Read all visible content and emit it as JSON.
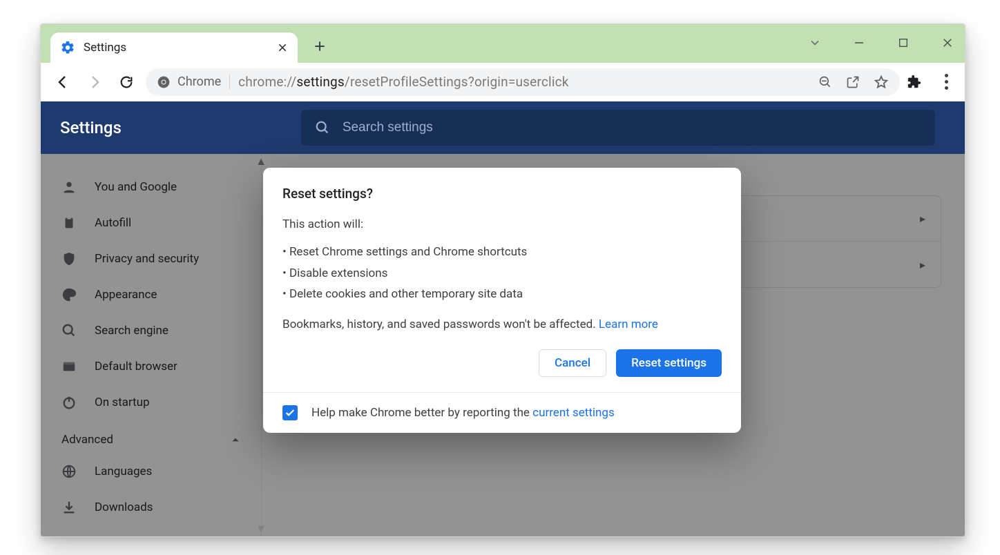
{
  "tab": {
    "title": "Settings"
  },
  "omnibox": {
    "chip_label": "Chrome",
    "url_gray1": "chrome://",
    "url_dark": "settings",
    "url_gray2": "/resetProfileSettings?origin=userclick"
  },
  "settings_header": {
    "label": "Settings"
  },
  "search": {
    "placeholder": "Search settings"
  },
  "sidebar": {
    "items": [
      {
        "label": "You and Google"
      },
      {
        "label": "Autofill"
      },
      {
        "label": "Privacy and security"
      },
      {
        "label": "Appearance"
      },
      {
        "label": "Search engine"
      },
      {
        "label": "Default browser"
      },
      {
        "label": "On startup"
      }
    ],
    "advanced_label": "Advanced",
    "extra": [
      {
        "label": "Languages"
      },
      {
        "label": "Downloads"
      }
    ]
  },
  "dialog": {
    "title": "Reset settings?",
    "intro": "This action will:",
    "bullet1": "• Reset Chrome settings and Chrome shortcuts",
    "bullet2": "• Disable extensions",
    "bullet3": "• Delete cookies and other temporary site data",
    "note_text": "Bookmarks, history, and saved passwords won't be affected. ",
    "learn_more": "Learn more",
    "cancel": "Cancel",
    "confirm": "Reset settings",
    "footer_text": "Help make Chrome better by reporting the ",
    "footer_link": "current settings"
  }
}
